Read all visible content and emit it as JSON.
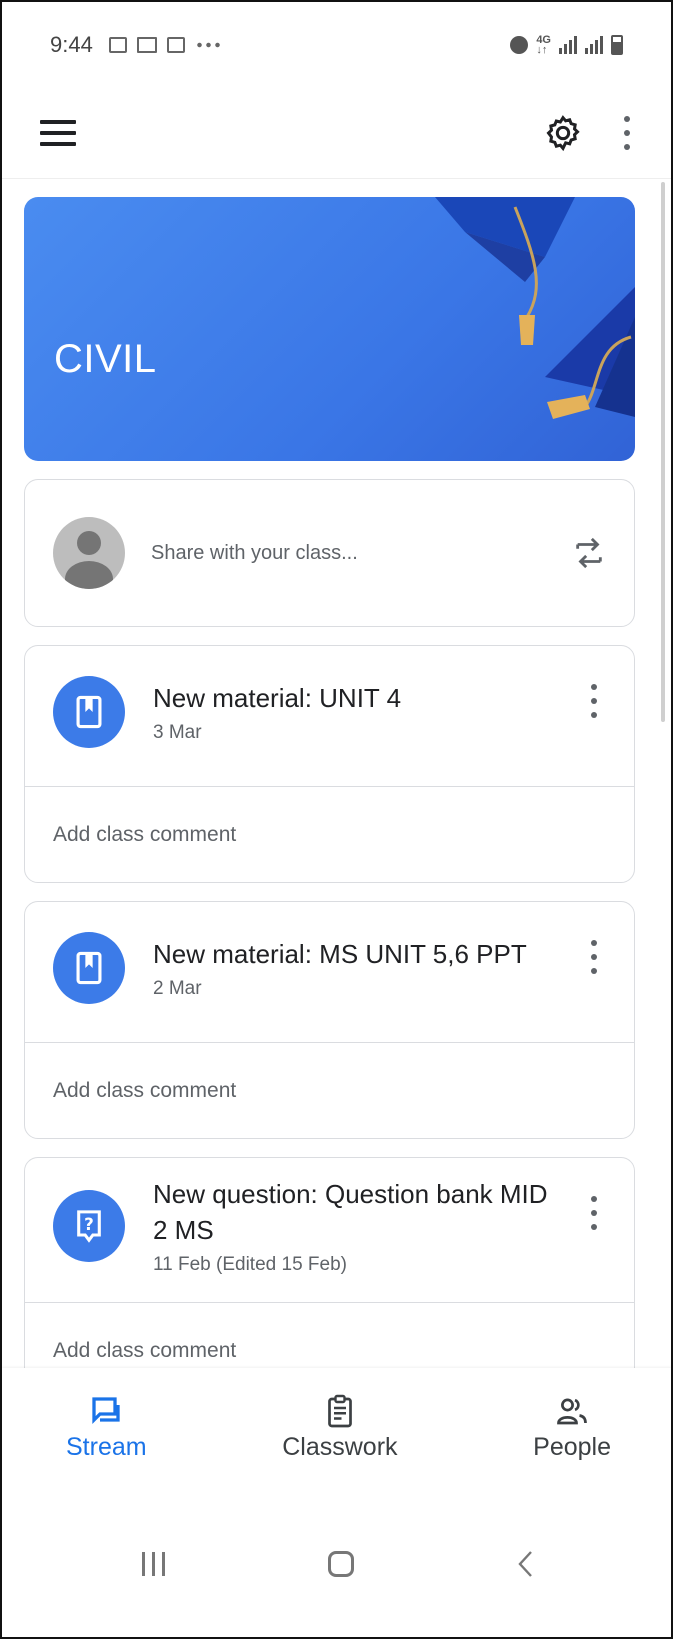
{
  "status_bar": {
    "time": "9:44"
  },
  "class": {
    "name": "CIVIL"
  },
  "share": {
    "placeholder": "Share with your class..."
  },
  "posts": [
    {
      "title": "New material: UNIT 4",
      "date": "3 Mar",
      "comment_label": "Add class comment",
      "icon": "material-book-icon"
    },
    {
      "title": "New material: MS UNIT 5,6 PPT",
      "date": "2 Mar",
      "comment_label": "Add class comment",
      "icon": "material-book-icon"
    },
    {
      "title": "New question: Question bank MID 2 MS",
      "date": "11 Feb (Edited 15 Feb)",
      "comment_label": "Add class comment",
      "icon": "question-icon"
    }
  ],
  "bottom_nav": {
    "items": [
      {
        "label": "Stream",
        "active": true
      },
      {
        "label": "Classwork",
        "active": false
      },
      {
        "label": "People",
        "active": false
      }
    ]
  },
  "colors": {
    "accent": "#1a73e8",
    "banner": "#3a76e6",
    "text": "#202124",
    "secondary": "#5f6368"
  }
}
